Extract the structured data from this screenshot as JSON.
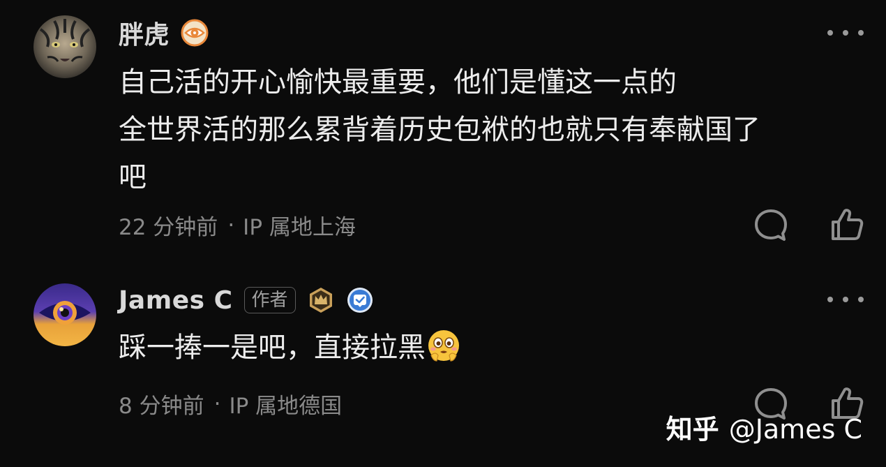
{
  "comments": [
    {
      "username": "胖虎",
      "badge_icon": "eye-badge-icon",
      "body_lines": [
        "自己活的开心愉快最重要，他们是懂这一点的",
        "全世界活的那么累背着历史包袱的也就只有奉献国了",
        "吧"
      ],
      "time": "22 分钟前",
      "separator": "·",
      "location": "IP 属地上海"
    },
    {
      "username": "James C",
      "author_tag": "作者",
      "badge_icons": [
        "crown-badge-icon",
        "verified-badge-icon"
      ],
      "body_text": "踩一捧一是吧，直接拉黑",
      "emoji_icon": "drooling-face-emoji-icon",
      "time": "8 分钟前",
      "separator": "·",
      "location": "IP 属地德国"
    }
  ],
  "watermark": {
    "brand": "知乎",
    "handle": "@James C"
  },
  "colors": {
    "background": "#0b0b0b",
    "text": "#ededed",
    "meta": "#8a8a8a",
    "badge_orange": "#e9883a",
    "badge_gold": "#c9a05a",
    "badge_blue": "#3a7bd5"
  }
}
